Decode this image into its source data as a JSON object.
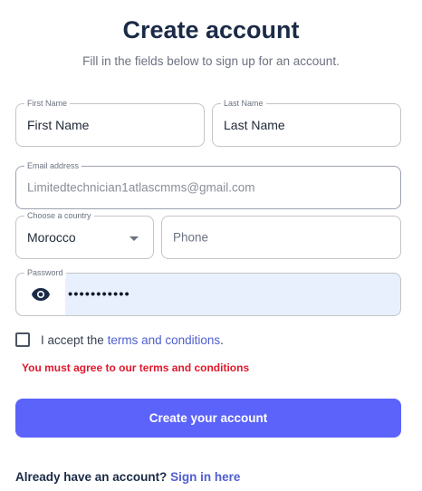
{
  "header": {
    "title": "Create account",
    "subtitle": "Fill in the fields below to sign up for an account."
  },
  "form": {
    "first_name": {
      "label": "First Name",
      "value": "First Name"
    },
    "last_name": {
      "label": "Last Name",
      "value": "Last Name"
    },
    "email": {
      "label": "Email address",
      "value": "Limitedtechnician1atlascmms@gmail.com"
    },
    "country": {
      "label": "Choose a country",
      "value": "Morocco"
    },
    "phone": {
      "placeholder": "Phone"
    },
    "password": {
      "label": "Password",
      "masked_value": "•••••••••••"
    },
    "terms": {
      "prefix": "I accept the",
      "link": "terms and conditions",
      "suffix": ".",
      "checked": false
    },
    "error": "You must agree to our terms and conditions",
    "submit_label": "Create your account"
  },
  "footer": {
    "prompt": "Already have an account?",
    "link": "Sign in here"
  },
  "colors": {
    "primary": "#5b63fb",
    "link": "#4f5fcf",
    "error": "#e0182d",
    "autofill": "#e8f0fe"
  },
  "icons": {
    "password_toggle": "eye-icon",
    "country_select": "caret-down-icon"
  }
}
